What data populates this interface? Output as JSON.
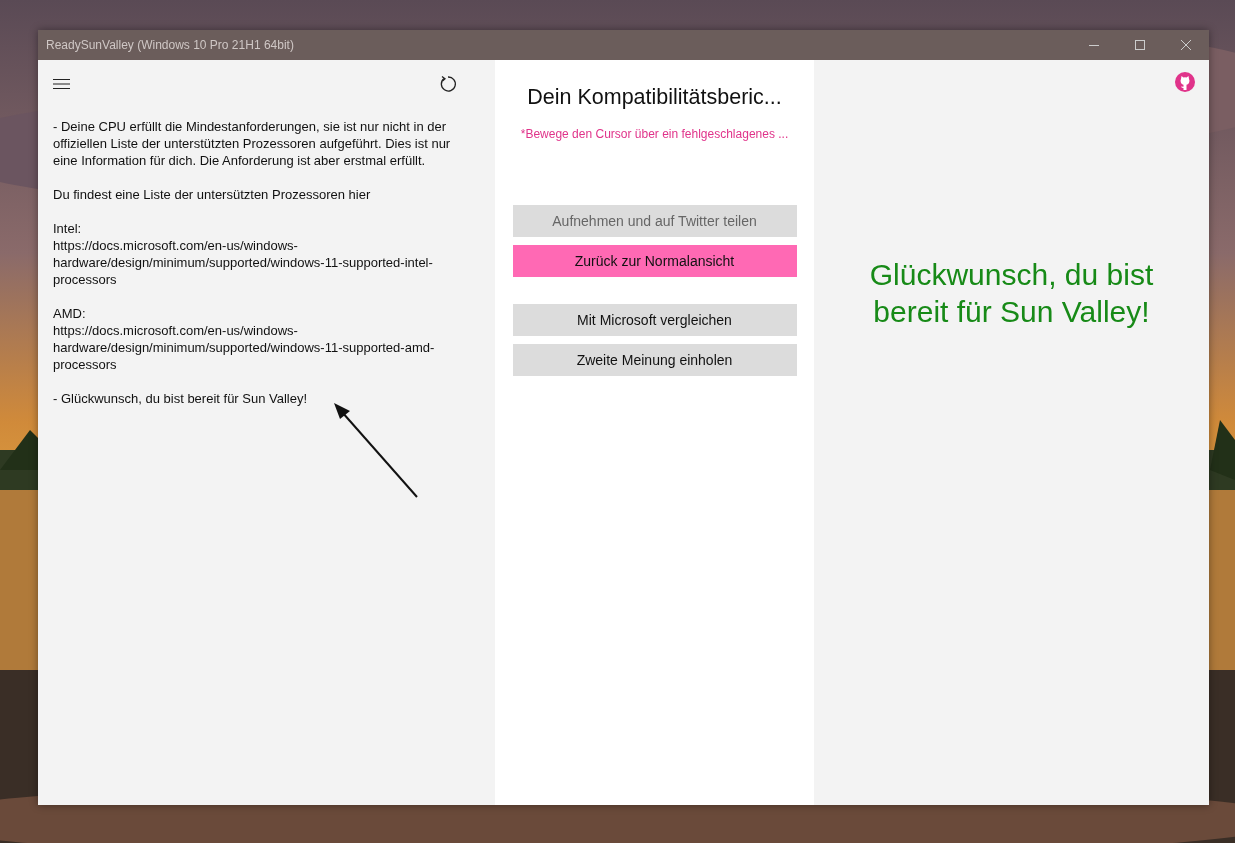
{
  "window": {
    "title": "ReadySunValley (Windows 10 Pro 21H1 64bit)"
  },
  "report": {
    "paragraphs": [
      {
        "lines": [
          "- Deine CPU erfüllt die Mindestanforderungen, sie ist nur nicht in der offiziellen Liste der unterstützten Prozessoren aufgeführt. Dies ist nur eine Information für dich. Die Anforderung ist aber erstmal erfüllt."
        ]
      },
      {
        "lines": [
          "Du findest eine Liste der untersützten Prozessoren hier"
        ]
      },
      {
        "lines": [
          "Intel:",
          "https://docs.microsoft.com/en-us/windows-hardware/design/minimum/supported/windows-11-supported-intel-processors"
        ]
      },
      {
        "lines": [
          "AMD:",
          "https://docs.microsoft.com/en-us/windows-hardware/design/minimum/supported/windows-11-supported-amd-processors"
        ]
      },
      {
        "lines": [
          "- Glückwunsch, du bist bereit für Sun Valley!"
        ]
      }
    ]
  },
  "middle": {
    "heading": "Dein Kompatibilitätsberic...",
    "hint": "*Bewege den Cursor über ein fehlgeschlagenes ...",
    "buttons": [
      {
        "label": "Aufnehmen und auf Twitter teilen",
        "kind": "normal",
        "disabled": true
      },
      {
        "label": "Zurück zur Normalansicht",
        "kind": "accent",
        "disabled": false
      },
      {
        "label": "Mit Microsoft vergleichen",
        "kind": "normal",
        "disabled": false
      },
      {
        "label": "Zweite Meinung einholen",
        "kind": "normal",
        "disabled": false
      }
    ]
  },
  "result": {
    "message": "Glückwunsch, du bist bereit für Sun Valley!"
  }
}
